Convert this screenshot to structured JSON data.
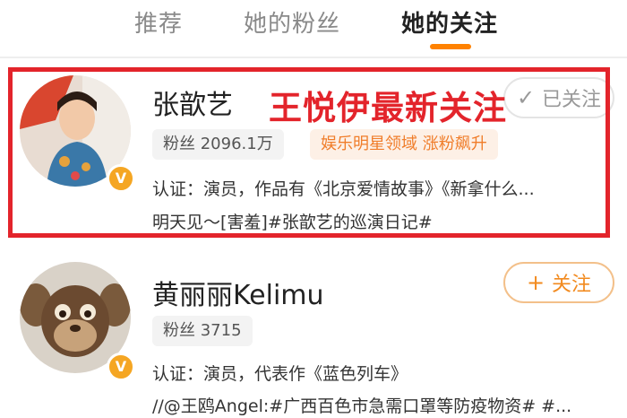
{
  "tabs": [
    {
      "label": "推荐",
      "active": false
    },
    {
      "label": "她的粉丝",
      "active": false
    },
    {
      "label": "她的关注",
      "active": true
    }
  ],
  "accent_color": "#ff8200",
  "highlight_color": "#e3242b",
  "overlay_title": "王悦伊最新关注",
  "users": [
    {
      "name": "张歆艺",
      "follow_label": "已关注",
      "follow_icon": "check-icon",
      "fans_label": "粉丝 2096.1万",
      "hot_tag": "娱乐明星领域 涨粉飙升",
      "verified_badge": "V",
      "verify_text": "认证：演员，作品有《北京爱情故事》《新拿什么...",
      "status_text": "明天见～[害羞]#张歆艺的巡演日记#"
    },
    {
      "name": "黄丽丽Kelimu",
      "follow_label": "关注",
      "follow_icon": "plus-icon",
      "fans_label": "粉丝 3715",
      "verified_badge": "V",
      "verify_text": "认证：演员，代表作《蓝色列车》",
      "status_text": "//@王鸥Angel:#广西百色市急需口罩等防疫物资# #..."
    }
  ]
}
